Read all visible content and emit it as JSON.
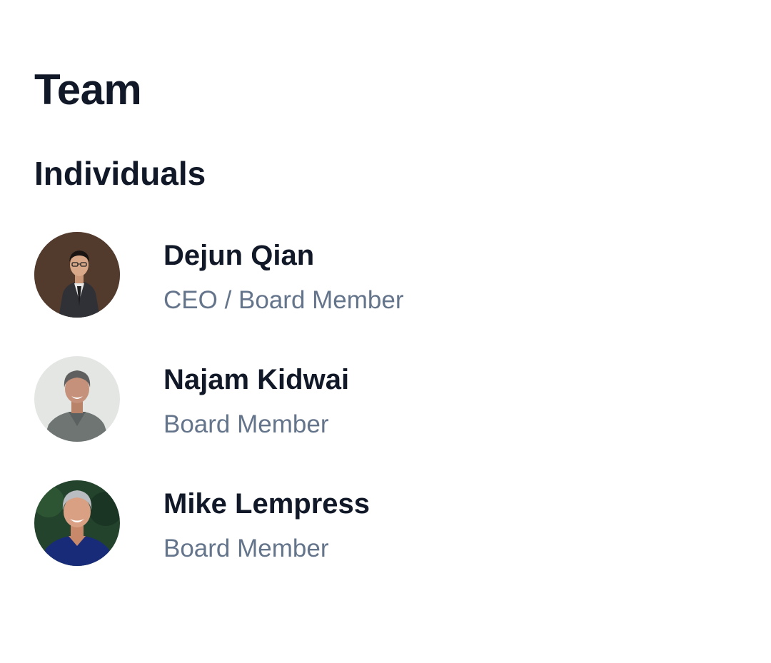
{
  "page": {
    "title": "Team"
  },
  "section": {
    "title": "Individuals"
  },
  "members": [
    {
      "name": "Dejun Qian",
      "role": "CEO / Board Member",
      "avatar_icon": "person-photo-avatar"
    },
    {
      "name": "Najam Kidwai",
      "role": "Board Member",
      "avatar_icon": "person-photo-avatar"
    },
    {
      "name": "Mike Lempress",
      "role": "Board Member",
      "avatar_icon": "person-photo-avatar"
    }
  ],
  "colors": {
    "heading": "#111827",
    "role_text": "#64748b",
    "background": "#ffffff"
  }
}
